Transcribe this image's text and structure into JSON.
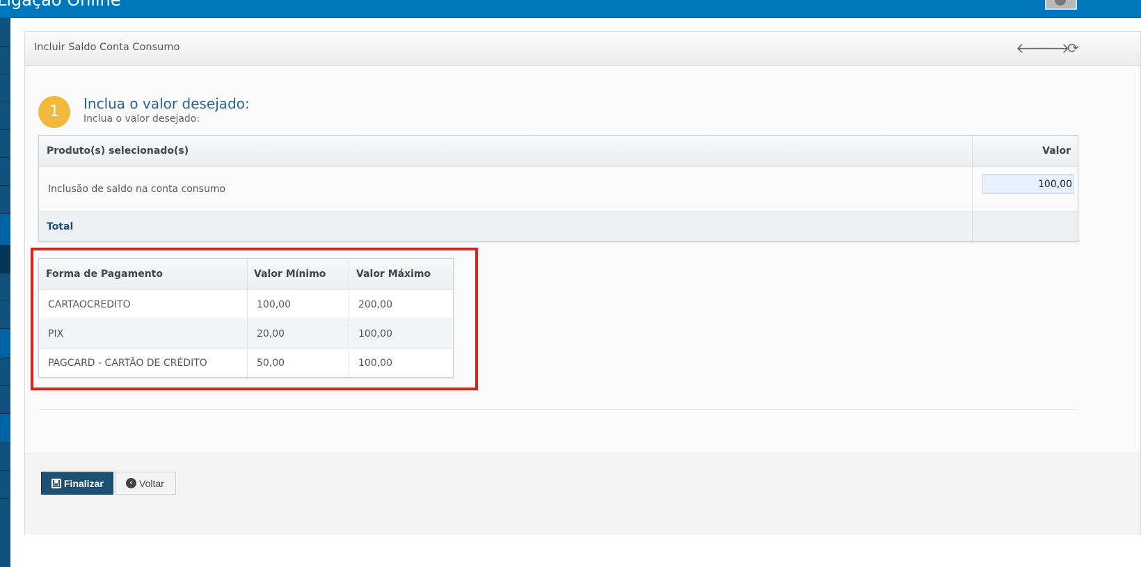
{
  "app": {
    "title": "Ligação Online"
  },
  "portlet": {
    "title": "Incluir Saldo Conta Consumo",
    "tools": {
      "back_glyph": "🡐",
      "forward_glyph": "🡒",
      "refresh_glyph": "⟳"
    }
  },
  "step": {
    "number": "1",
    "title": "Inclua o valor desejado:",
    "subtitle": "Inclua o valor desejado:"
  },
  "products_table": {
    "headers": [
      "Produto(s) selecionado(s)",
      "Valor"
    ],
    "rows": [
      {
        "produto": "Inclusão de saldo na conta consumo",
        "valor": "100,00"
      }
    ],
    "total_label": "Total",
    "total_value": ""
  },
  "payment_table": {
    "headers": [
      "Forma de Pagamento",
      "Valor Mínimo",
      "Valor Máximo"
    ],
    "rows": [
      {
        "forma": "CARTAOCREDITO",
        "min": "100,00",
        "max": "200,00"
      },
      {
        "forma": "PIX",
        "min": "20,00",
        "max": "100,00"
      },
      {
        "forma": "PAGCARD - CARTÃO DE CRÉDITO",
        "min": "50,00",
        "max": "100,00"
      }
    ]
  },
  "actions": {
    "finalize_label": "Finalizar",
    "back_label": "Voltar"
  },
  "colors": {
    "topbar": "#0077bd",
    "primary_button": "#1b4f73",
    "step_badge": "#f0b93c",
    "highlight": "#d9231c",
    "title_blue": "#27648f"
  },
  "icons": [
    "user-avatar-icon",
    "arrow-left-icon",
    "arrow-right-icon",
    "refresh-icon",
    "save-icon",
    "back-circle-icon"
  ]
}
